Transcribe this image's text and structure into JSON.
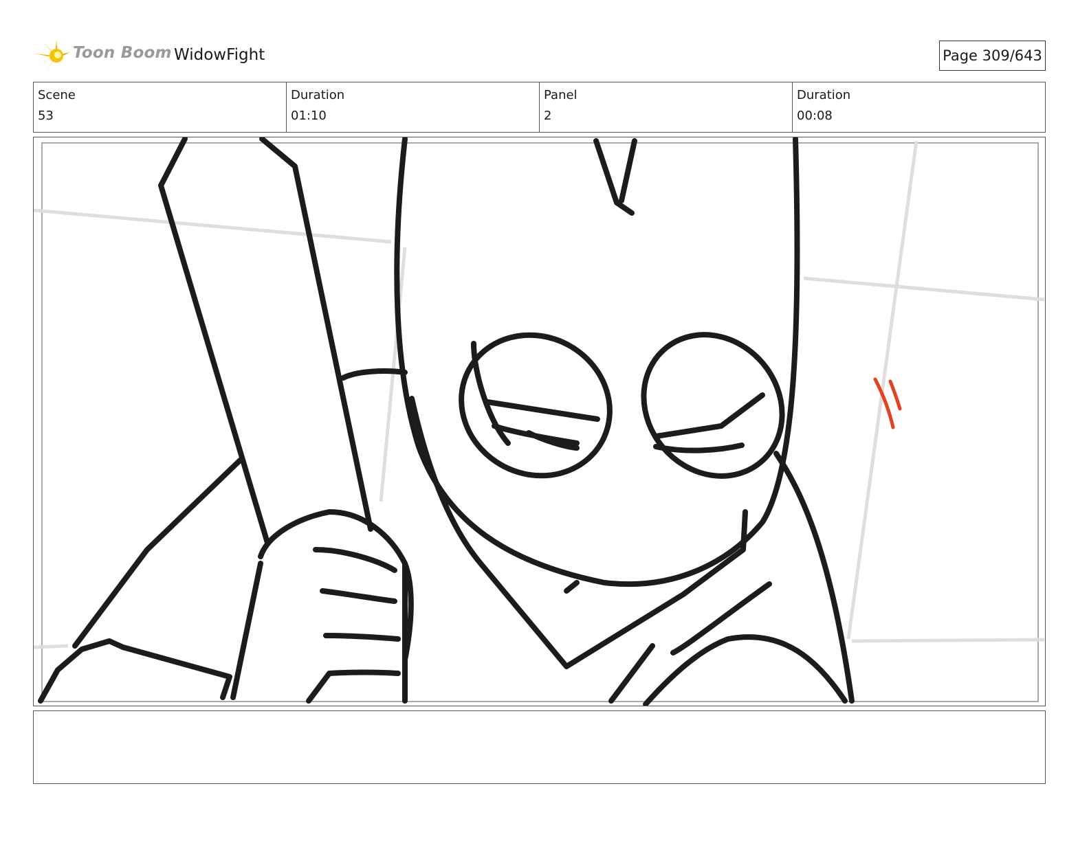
{
  "header": {
    "logo_text": "Toon Boom",
    "project_title": "WidowFight",
    "page_number": "Page 309/643"
  },
  "info": {
    "scene_label": "Scene",
    "scene_value": "53",
    "scene_duration_label": "Duration",
    "scene_duration_value": "01:10",
    "panel_label": "Panel",
    "panel_value": "2",
    "panel_duration_label": "Duration",
    "panel_duration_value": "00:08"
  },
  "colors": {
    "logo_accent": "#f5c400",
    "sketch_line": "#1c1c1c",
    "guide_line": "#dcdcdc",
    "accent_mark": "#e8401c"
  },
  "notes": {
    "text": ""
  }
}
